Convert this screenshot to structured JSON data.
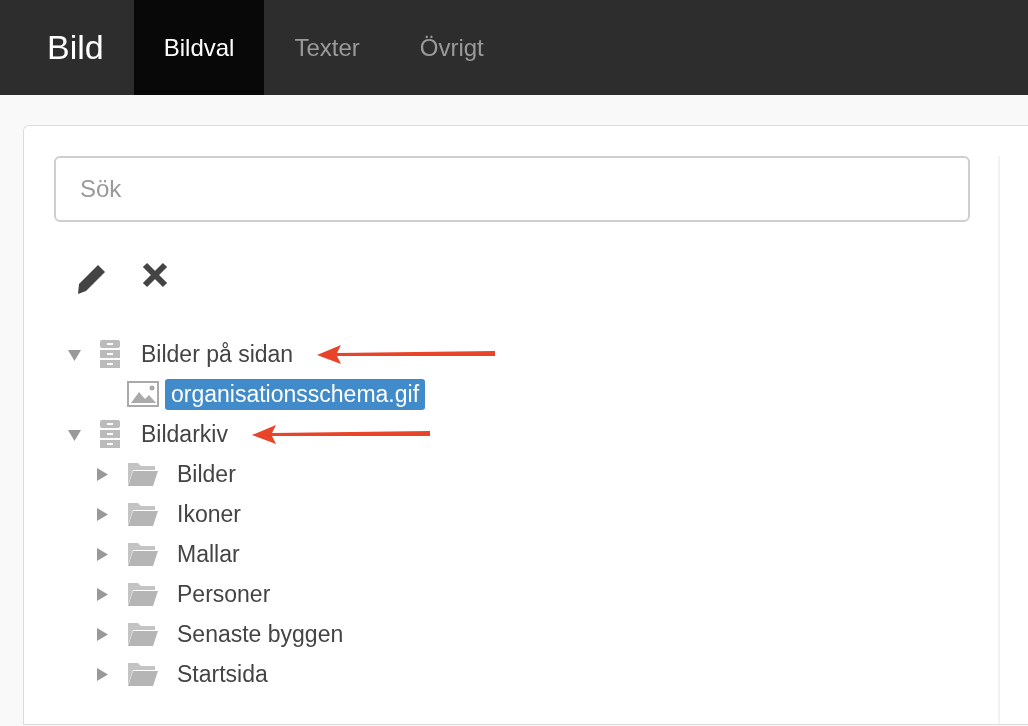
{
  "header": {
    "title": "Bild",
    "tabs": [
      {
        "label": "Bildval",
        "selected": true
      },
      {
        "label": "Texter",
        "selected": false
      },
      {
        "label": "Övrigt",
        "selected": false
      }
    ]
  },
  "search": {
    "placeholder": "Sök"
  },
  "tree": [
    {
      "kind": "archive",
      "label": "Bilder på sidan",
      "expanded": true,
      "selected": false,
      "arrow": true,
      "children": [
        {
          "kind": "image",
          "label": "organisationsschema.gif",
          "selected": true
        }
      ]
    },
    {
      "kind": "archive",
      "label": "Bildarkiv",
      "expanded": true,
      "selected": false,
      "arrow": true,
      "children": [
        {
          "kind": "folder",
          "label": "Bilder",
          "expanded": false,
          "selected": false
        },
        {
          "kind": "folder",
          "label": "Ikoner",
          "expanded": false,
          "selected": false
        },
        {
          "kind": "folder",
          "label": "Mallar",
          "expanded": false,
          "selected": false
        },
        {
          "kind": "folder",
          "label": "Personer",
          "expanded": false,
          "selected": false
        },
        {
          "kind": "folder",
          "label": "Senaste byggen",
          "expanded": false,
          "selected": false
        },
        {
          "kind": "folder",
          "label": "Startsida",
          "expanded": false,
          "selected": false
        }
      ]
    }
  ]
}
